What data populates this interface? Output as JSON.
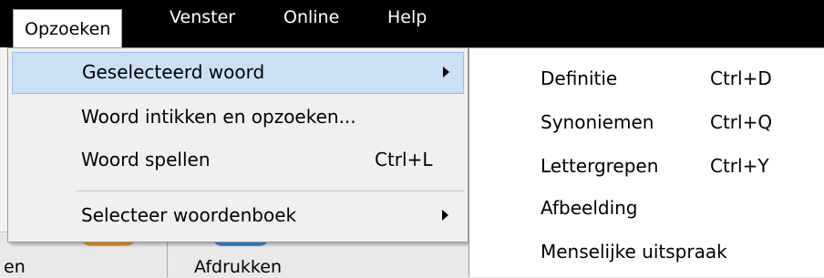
{
  "menubar": {
    "items": [
      {
        "label": "Opzoeken",
        "active": true
      },
      {
        "label": "Venster",
        "active": false
      },
      {
        "label": "Online",
        "active": false
      },
      {
        "label": "Help",
        "active": false
      }
    ]
  },
  "menu": {
    "items": [
      {
        "label": "Geselecteerd woord",
        "shortcut": "",
        "has_submenu": true,
        "highlighted": true
      },
      {
        "label": "Woord intikken en opzoeken...",
        "shortcut": "",
        "has_submenu": false,
        "highlighted": false
      },
      {
        "label": "Woord spellen",
        "shortcut": "Ctrl+L",
        "has_submenu": false,
        "highlighted": false
      },
      {
        "label": "Selecteer woordenboek",
        "shortcut": "",
        "has_submenu": true,
        "highlighted": false
      }
    ]
  },
  "submenu": {
    "items": [
      {
        "label": "Definitie",
        "shortcut": "Ctrl+D"
      },
      {
        "label": "Synoniemen",
        "shortcut": "Ctrl+Q"
      },
      {
        "label": "Lettergrepen",
        "shortcut": "Ctrl+Y"
      },
      {
        "label": "Afbeelding",
        "shortcut": ""
      },
      {
        "label": "Menselijke uitspraak",
        "shortcut": ""
      }
    ]
  },
  "toolbar": {
    "left_label": "en",
    "print_label": "Afdrukken"
  },
  "colors": {
    "menubar_bg": "#000000",
    "highlight": "#cce0f4",
    "highlight_border": "#99bde6",
    "orange_icon": "#f6a020",
    "blue_icon": "#3d8fe6"
  }
}
